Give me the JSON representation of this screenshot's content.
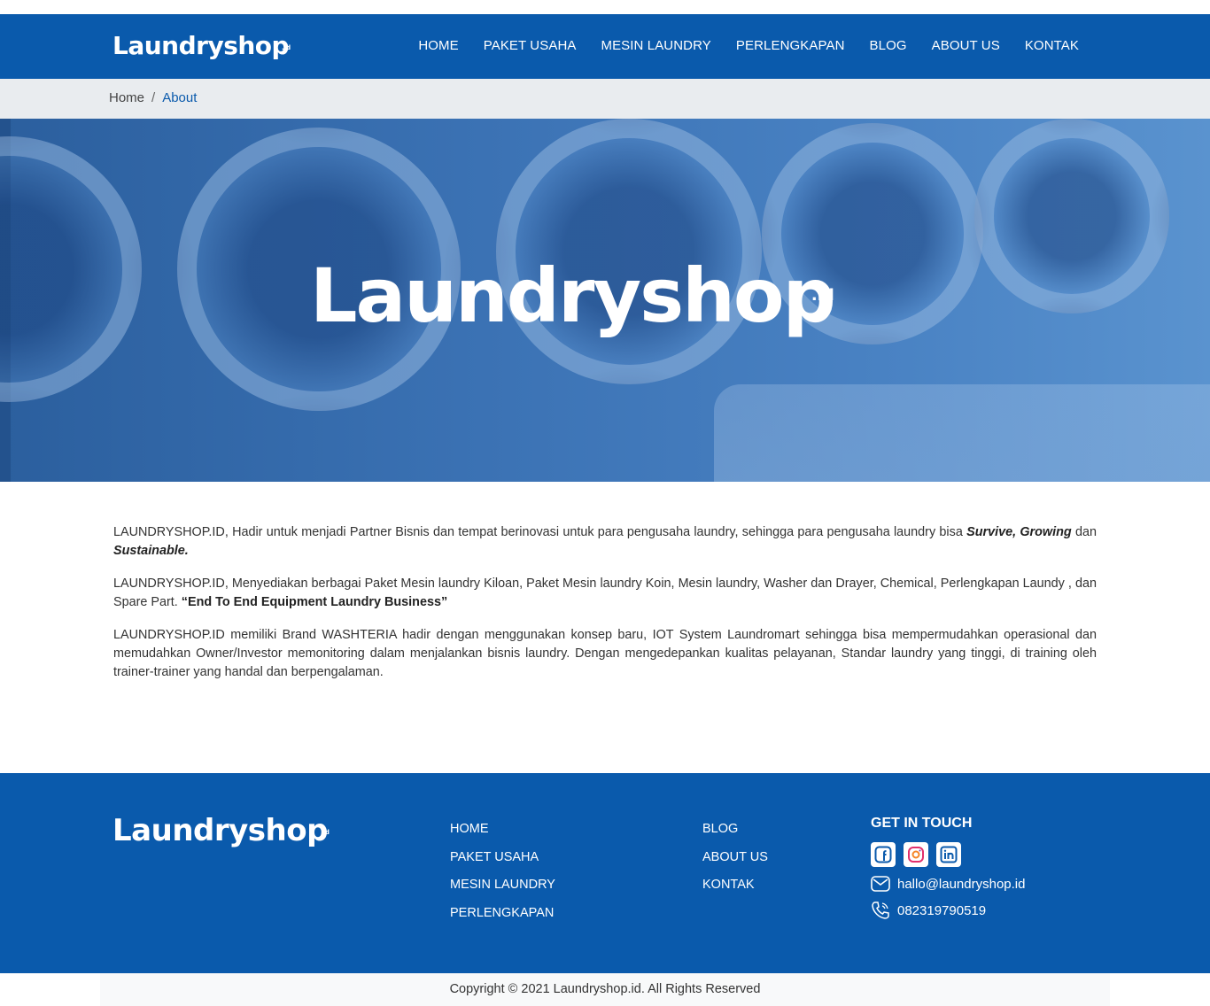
{
  "header": {
    "logo_text": "Laundryshop",
    "logo_suffix": ".id",
    "nav": [
      "HOME",
      "PAKET USAHA",
      "MESIN LAUNDRY",
      "PERLENGKAPAN",
      "BLOG",
      "ABOUT US",
      "KONTAK"
    ]
  },
  "breadcrumb": {
    "home": "Home",
    "separator": "/",
    "current": "About"
  },
  "hero": {
    "logo_text": "Laundryshop",
    "logo_suffix": ".id"
  },
  "content": {
    "p1_text": "LAUNDRYSHOP.ID, Hadir untuk menjadi Partner Bisnis dan tempat berinovasi untuk para pengusaha laundry, sehingga para pengusaha laundry bisa ",
    "p1_em1": "Survive, Growing",
    "p1_mid": " dan ",
    "p1_em2": "Sustainable.",
    "p2_text": "LAUNDRYSHOP.ID, Menyediakan berbagai Paket Mesin laundry Kiloan, Paket Mesin laundry Koin, Mesin laundry, Washer dan Drayer, Chemical, Perlengkapan Laundy , dan Spare Part. ",
    "p2_bold": "“End To End Equipment Laundry Business”",
    "p3_text": "LAUNDRYSHOP.ID  memiliki Brand WASHTERIA hadir dengan menggunakan konsep baru, IOT System Laundromart sehingga bisa mempermudahkan operasional dan memudahkan Owner/Investor memonitoring dalam menjalankan bisnis laundry. Dengan mengedepankan kualitas pelayanan, Standar laundry yang tinggi, di training oleh trainer-trainer yang handal dan berpengalaman."
  },
  "footer": {
    "logo_text": "Laundryshop",
    "logo_suffix": ".id",
    "col1": [
      "HOME",
      "PAKET USAHA",
      "MESIN LAUNDRY",
      "PERLENGKAPAN"
    ],
    "col2": [
      "BLOG",
      "ABOUT US",
      "KONTAK"
    ],
    "touch_title": "GET IN TOUCH",
    "socials": [
      "facebook-icon",
      "instagram-icon",
      "linkedin-icon"
    ],
    "email": "hallo@laundryshop.id",
    "phone": "082319790519",
    "copyright": "Copyright © 2021 Laundryshop.id. All Rights Reserved"
  },
  "colors": {
    "brand_blue": "#0a5aac",
    "breadcrumb_bg": "#e9ecef",
    "copyright_bg": "#f8f9fa"
  }
}
